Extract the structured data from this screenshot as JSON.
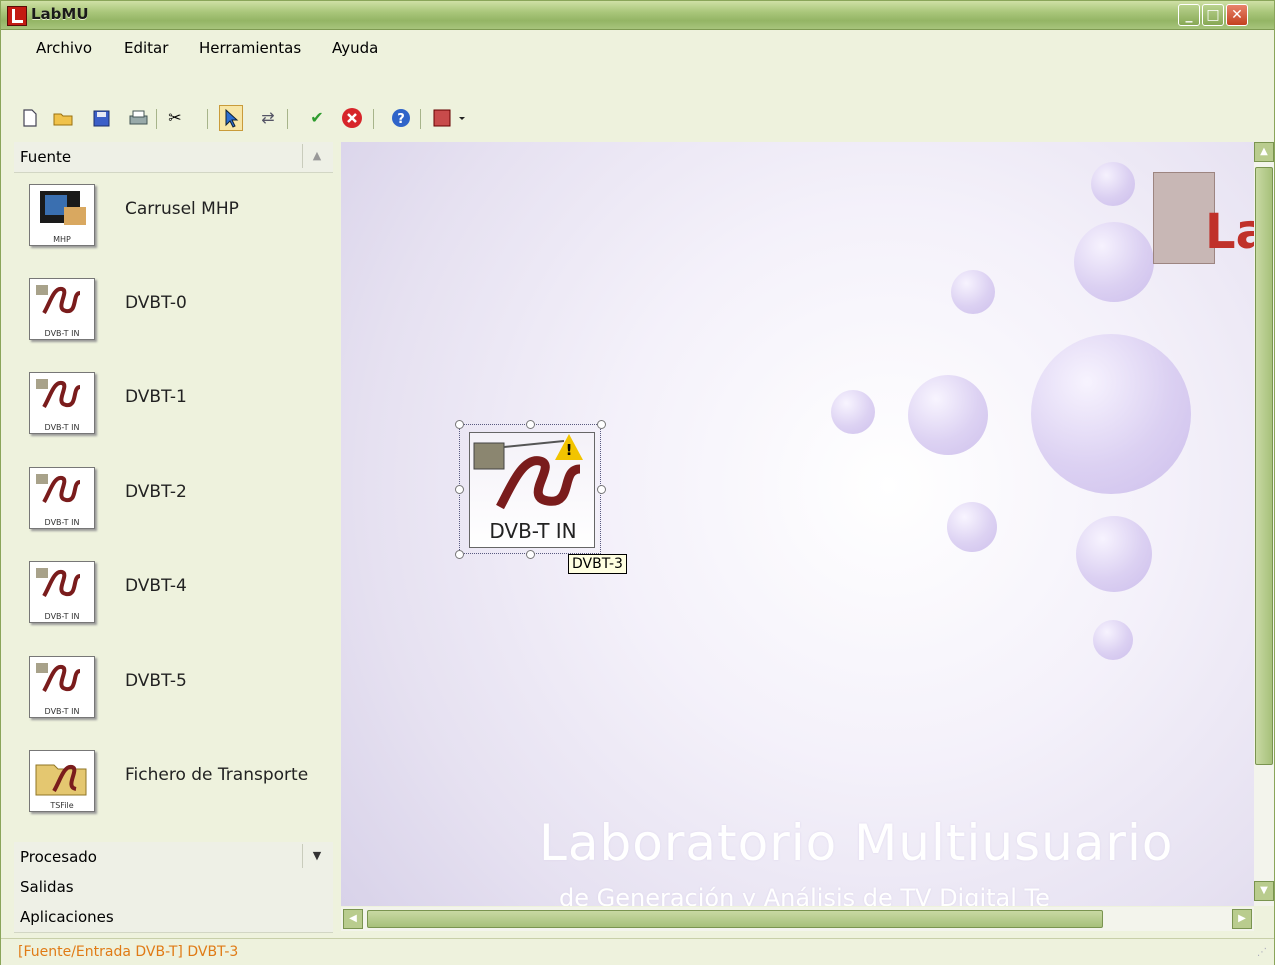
{
  "window": {
    "title": "LabMU"
  },
  "menu": [
    {
      "label": "Archivo"
    },
    {
      "label": "Editar"
    },
    {
      "label": "Herramientas"
    },
    {
      "label": "Ayuda"
    }
  ],
  "toolbar_icons": [
    "new-file-icon",
    "open-folder-icon",
    "save-icon",
    "print-icon",
    "cut-icon",
    "select-pointer-icon",
    "connect-arrows-icon",
    "validate-check-icon",
    "stop-icon",
    "help-icon",
    "labmu-menu-icon"
  ],
  "sidebar": {
    "top_group": "Fuente",
    "items": [
      {
        "label": "Carrusel MHP",
        "caption": "MHP"
      },
      {
        "label": "DVBT-0",
        "caption": "DVB-T IN"
      },
      {
        "label": "DVBT-1",
        "caption": "DVB-T IN"
      },
      {
        "label": "DVBT-2",
        "caption": "DVB-T IN"
      },
      {
        "label": "DVBT-4",
        "caption": "DVB-T IN"
      },
      {
        "label": "DVBT-5",
        "caption": "DVB-T IN"
      },
      {
        "label": "Fichero de Transporte",
        "caption": "TSFile"
      }
    ],
    "bottom_groups": [
      "Procesado",
      "Salidas",
      "Aplicaciones"
    ]
  },
  "canvas": {
    "watermark_title": "Laboratorio Multiusuario",
    "watermark_subtitle": "de Generación y Análisis de TV Digital Te",
    "logo_text": "Lab",
    "node": {
      "caption": "DVB-T IN",
      "tooltip": "DVBT-3"
    }
  },
  "status": {
    "text": "[Fuente/Entrada DVB-T] DVBT-3"
  },
  "colors": {
    "status_text": "#e07b16",
    "titlebar": "#a9c67a",
    "close_button": "#c3411f"
  }
}
